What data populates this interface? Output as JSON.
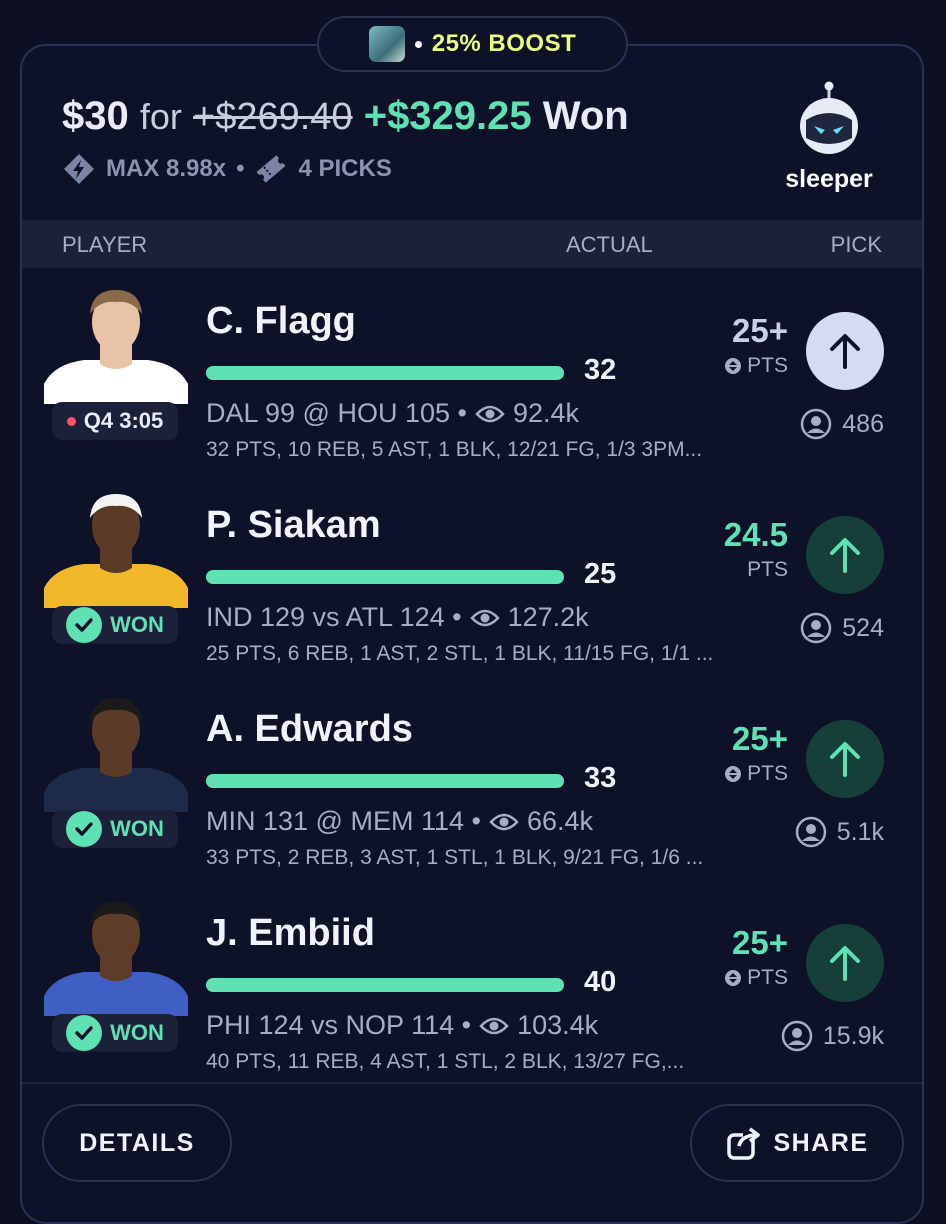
{
  "boost": {
    "label": "25% BOOST"
  },
  "header": {
    "stake": "$30",
    "for_word": "for",
    "original_payout": "+$269.40",
    "won_amount": "+$329.25",
    "won_word": "Won",
    "max_multiplier": "MAX 8.98x",
    "separator": "•",
    "picks_count": "4 PICKS",
    "brand": "sleeper"
  },
  "columns": {
    "player": "PLAYER",
    "actual": "ACTUAL",
    "pick": "PICK"
  },
  "rows": [
    {
      "name": "C. Flagg",
      "status": "Q4 3:05",
      "status_type": "live",
      "actual": "32",
      "game": "DAL 99 @ HOU 105 •",
      "views": "92.4k",
      "stats": "32 PTS, 10 REB, 5 AST, 1 BLK, 12/21 FG, 1/3 3PM...",
      "line": "25+",
      "unit": "PTS",
      "line_style": "pending",
      "pickers": "486",
      "jersey_color": "#ffffff",
      "skin_color": "#e8c3a6",
      "hair_color": "#8a6a4a"
    },
    {
      "name": "P. Siakam",
      "status": "WON",
      "status_type": "won",
      "actual": "25",
      "game": "IND 129 vs ATL 124 •",
      "views": "127.2k",
      "stats": "25 PTS, 6 REB, 1 AST, 2 STL, 1 BLK, 11/15 FG, 1/1 ...",
      "line": "24.5",
      "unit": "PTS",
      "line_style": "won",
      "pickers": "524",
      "jersey_color": "#f2b82b",
      "skin_color": "#5b3a26",
      "hair_color": "#f4f4f4"
    },
    {
      "name": "A. Edwards",
      "status": "WON",
      "status_type": "won",
      "actual": "33",
      "game": "MIN 131 @ MEM 114 •",
      "views": "66.4k",
      "stats": "33 PTS, 2 REB, 3 AST, 1 STL, 1 BLK, 9/21 FG, 1/6 ...",
      "line": "25+",
      "unit": "PTS",
      "line_style": "won",
      "pickers": "5.1k",
      "jersey_color": "#1d2a4a",
      "skin_color": "#5a3b28",
      "hair_color": "#1a1a1a"
    },
    {
      "name": "J. Embiid",
      "status": "WON",
      "status_type": "won",
      "actual": "40",
      "game": "PHI 124 vs NOP 114 •",
      "views": "103.4k",
      "stats": "40 PTS, 11 REB, 4 AST, 1 STL, 2 BLK, 13/27 FG,...",
      "line": "25+",
      "unit": "PTS",
      "line_style": "won",
      "pickers": "15.9k",
      "jersey_color": "#3f5fc4",
      "skin_color": "#5d3c28",
      "hair_color": "#1a1a1a"
    }
  ],
  "footer": {
    "details": "DETAILS",
    "share": "SHARE"
  },
  "colors": {
    "accent": "#5ee2b4",
    "boost": "#e8ff7c",
    "background": "#0d1024"
  }
}
